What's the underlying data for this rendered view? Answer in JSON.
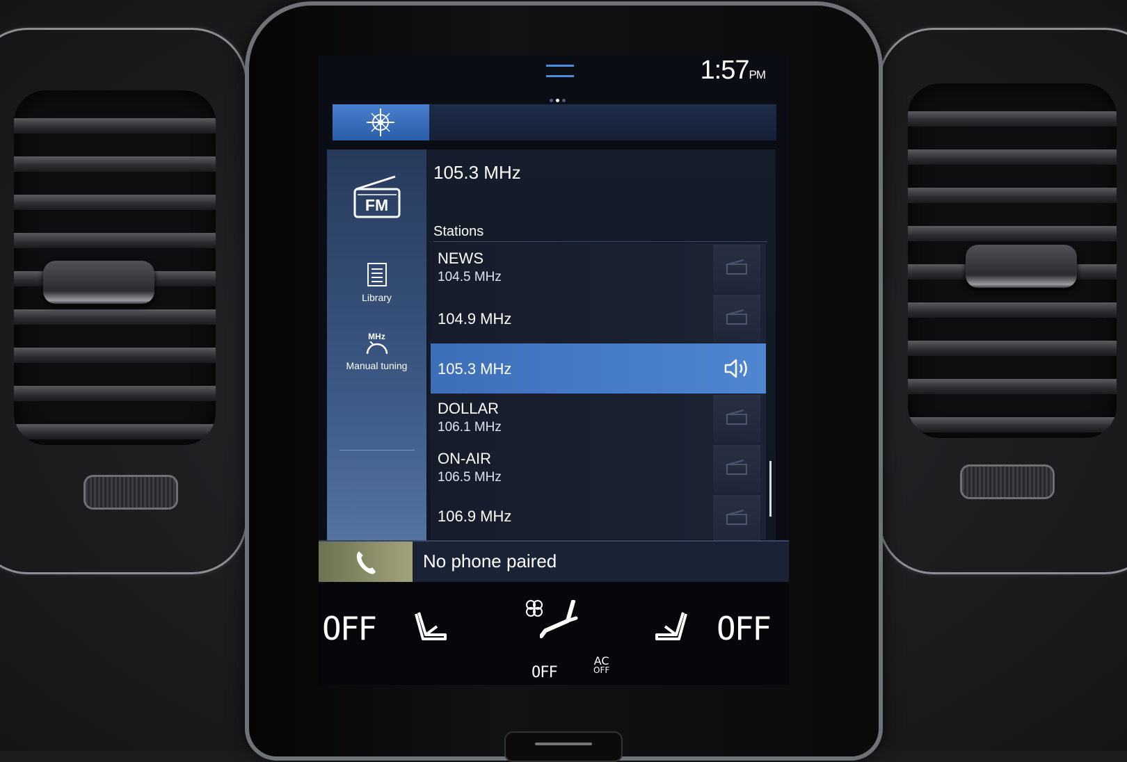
{
  "status": {
    "time": "1:57",
    "ampm": "PM"
  },
  "source": {
    "label": "FM",
    "current_frequency": "105.3 MHz"
  },
  "side_menu": {
    "library_label": "Library",
    "manual_tuning_label": "Manual tuning",
    "mhz_label": "MHz"
  },
  "stations": {
    "title": "Stations",
    "items": [
      {
        "name": "NEWS",
        "frequency": "104.5 MHz"
      },
      {
        "name": "",
        "frequency": "104.9 MHz"
      },
      {
        "name": "",
        "frequency": "105.3 MHz",
        "selected": true
      },
      {
        "name": "DOLLAR",
        "frequency": "106.1 MHz"
      },
      {
        "name": "ON-AIR",
        "frequency": "106.5 MHz"
      },
      {
        "name": "",
        "frequency": "106.9 MHz"
      }
    ]
  },
  "phone": {
    "status": "No phone paired"
  },
  "climate": {
    "left_temp": "OFF",
    "right_temp": "OFF",
    "fan_label": "OFF",
    "ac_label": "AC",
    "ac_state": "OFF"
  },
  "colors": {
    "accent_blue": "#4a86d1",
    "selected_row": "#4f86d1",
    "phone_tile": "#a3a37a"
  }
}
